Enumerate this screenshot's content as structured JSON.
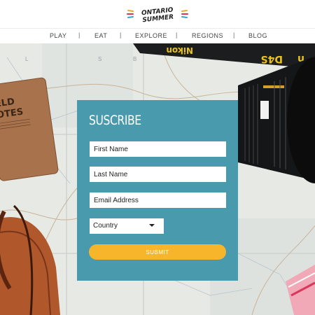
{
  "brand": {
    "logo_line1": "ONTARIO",
    "logo_line2": "SUMMER"
  },
  "nav": {
    "items": [
      "PLAY",
      "EAT",
      "EXPLORE",
      "REGIONS",
      "BLOG"
    ],
    "separator": "|"
  },
  "hero": {
    "notebook_text": [
      "ELD",
      "OTES"
    ],
    "strap_text": [
      "Nikon",
      "D4S",
      "n"
    ]
  },
  "form": {
    "title": "SUSCRIBE",
    "first_name_placeholder": "First Name",
    "last_name_placeholder": "Last Name",
    "email_placeholder": "Email Address",
    "country_label": "Country",
    "submit_label": "SUBMIT"
  },
  "colors": {
    "panel": "#4a9aae",
    "submit": "#f7b52c",
    "strap": "#1c1d1f",
    "strap_text": "#e8c21e"
  }
}
